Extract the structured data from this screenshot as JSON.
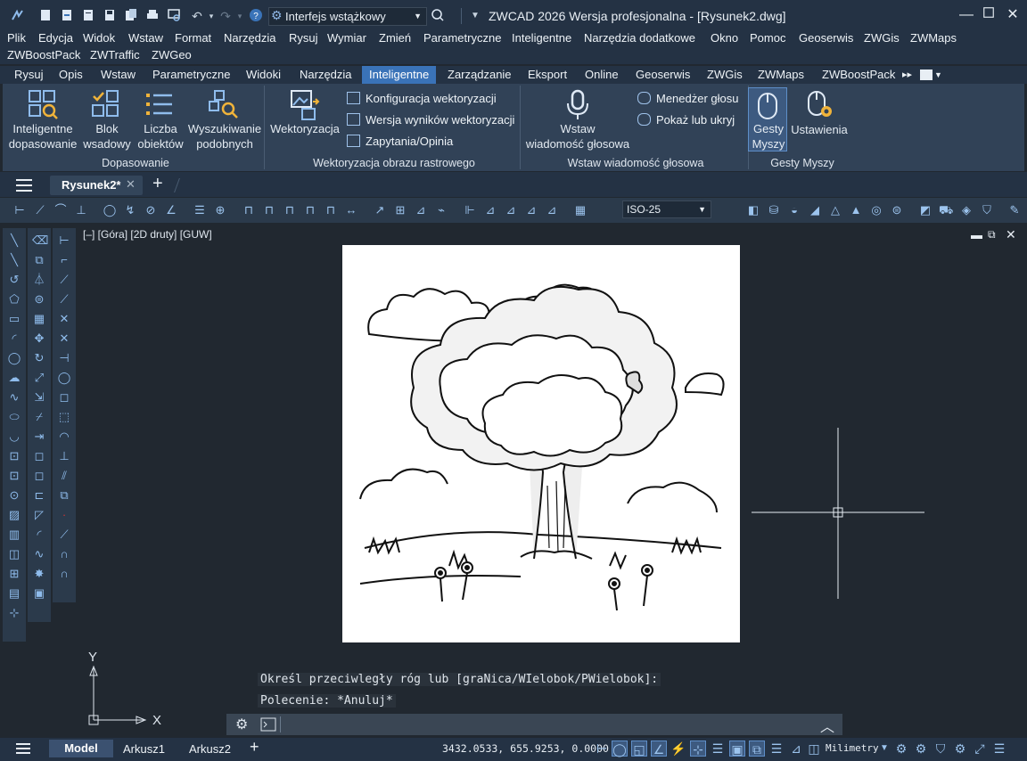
{
  "window": {
    "title": "ZWCAD 2026 Wersja profesjonalna - [Rysunek2.dwg]",
    "workspace": "Interfejs wstążkowy"
  },
  "menubar": {
    "row1": [
      "Plik",
      "Edycja",
      "Widok",
      "Wstaw",
      "Format",
      "Narzędzia",
      "Rysuj",
      "Wymiar",
      "Zmień",
      "Parametryczne",
      "Inteligentne",
      "Narzędzia dodatkowe",
      "Okno",
      "Pomoc",
      "Geoserwis",
      "ZWGis",
      "ZWMaps"
    ],
    "row2": [
      "ZWBoostPack",
      "ZWTraffic",
      "ZWGeo"
    ]
  },
  "ribbon_tabs": [
    "Rysuj",
    "Opis",
    "Wstaw",
    "Parametryczne",
    "Widoki",
    "Narzędzia",
    "Inteligentne",
    "Zarządzanie",
    "Eksport",
    "Online",
    "Geoserwis",
    "ZWGis",
    "ZWMaps",
    "ZWBoostPack"
  ],
  "ribbon_active_tab": "Inteligentne",
  "ribbon": {
    "dopasowanie": {
      "title": "Dopasowanie",
      "b1a": "Inteligentne",
      "b1b": "dopasowanie",
      "b2a": "Blok",
      "b2b": "wsadowy",
      "b3a": "Liczba",
      "b3b": "obiektów",
      "b4a": "Wyszukiwanie",
      "b4b": "podobnych"
    },
    "wektoryzacja": {
      "title": "Wektoryzacja obrazu rastrowego",
      "main": "Wektoryzacja",
      "s1": "Konfiguracja wektoryzacji",
      "s2": "Wersja wyników wektoryzacji",
      "s3": "Zapytania/Opinia"
    },
    "glos": {
      "title": "Wstaw wiadomość głosowa",
      "main_a": "Wstaw",
      "main_b": "wiadomość głosowa",
      "s1": "Menedżer głosu",
      "s2": "Pokaż lub ukryj"
    },
    "gesty": {
      "title": "Gesty Myszy",
      "b1a": "Gesty",
      "b1b": "Myszy",
      "b2": "Ustawienia"
    }
  },
  "doc_tab": "Rysunek2*",
  "dim_style": "ISO-25",
  "viewport_label": "[–] [Góra] [2D druty] [GUW]",
  "ucs": {
    "x": "X",
    "y": "Y"
  },
  "command_history": [
    "Określ przeciwległy róg lub [graNica/WIelobok/PWielobok]:",
    "Polecenie: *Anuluj*"
  ],
  "layout_tabs": [
    "Model",
    "Arkusz1",
    "Arkusz2"
  ],
  "coordinates": "3432.0533, 655.9253, 0.0000",
  "units": "Milimetry",
  "colors": {
    "accent": "#3a73b8",
    "bg": "#212830",
    "panel": "#314257"
  }
}
